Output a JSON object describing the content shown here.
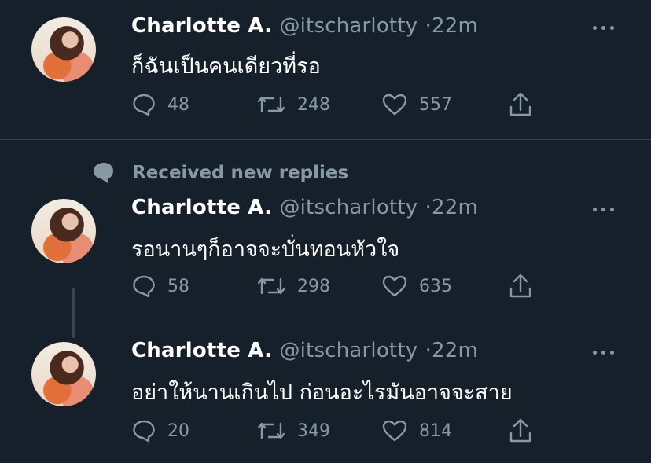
{
  "tweets": [
    {
      "name": "Charlotte A.",
      "handle": "@itscharlotty",
      "separator": "·",
      "time": "22m",
      "text": "ก็ฉันเป็นคนเดียวที่รอ",
      "replies": "48",
      "retweets": "248",
      "likes": "557"
    },
    {
      "name": "Charlotte A.",
      "handle": "@itscharlotty",
      "separator": "·",
      "time": "22m",
      "text": "รอนานๆก็อาจจะบั่นทอนหัวใจ",
      "replies": "58",
      "retweets": "298",
      "likes": "635"
    },
    {
      "name": "Charlotte A.",
      "handle": "@itscharlotty",
      "separator": "·",
      "time": "22m",
      "text": "อย่าให้นานเกินไป ก่อนอะไรมันอาจจะสาย",
      "replies": "20",
      "retweets": "349",
      "likes": "814"
    }
  ],
  "new_replies_label": "Received new replies",
  "colors": {
    "background": "#15202b",
    "secondary_text": "#8899a6",
    "divider": "#38444d"
  },
  "icons": {
    "reply": "speech-bubble-icon",
    "retweet": "retweet-icon",
    "like": "heart-icon",
    "share": "share-icon",
    "more": "more-dots-icon",
    "new_replies": "chat-bubble-icon"
  }
}
